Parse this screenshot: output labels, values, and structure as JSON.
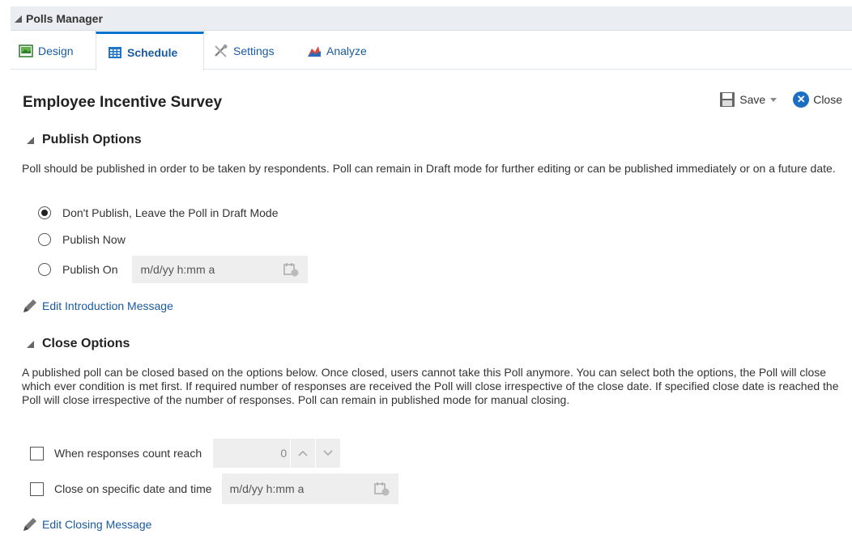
{
  "header": {
    "title": "Polls Manager"
  },
  "tabs": [
    {
      "label": "Design"
    },
    {
      "label": "Schedule"
    },
    {
      "label": "Settings"
    },
    {
      "label": "Analyze"
    }
  ],
  "page": {
    "title": "Employee Incentive Survey"
  },
  "toolbar": {
    "save_label": "Save",
    "close_label": "Close"
  },
  "publish": {
    "heading": "Publish Options",
    "description": "Poll should be published in order to be taken by respondents. Poll can remain in Draft mode for further editing or can be published immediately or on a future date.",
    "options": [
      {
        "label": "Don't Publish, Leave the Poll in Draft Mode",
        "checked": true
      },
      {
        "label": "Publish Now",
        "checked": false
      },
      {
        "label": "Publish On",
        "checked": false
      }
    ],
    "date_placeholder": "m/d/yy h:mm a",
    "edit_link": "Edit Introduction Message"
  },
  "close": {
    "heading": "Close Options",
    "description": "A published poll can be closed based on the options below. Once closed, users cannot take this Poll anymore. You can select both the options, the Poll will close which ever condition is met first. If required number of responses are received the Poll will close irrespective of the close date. If specified close date is reached the Poll will close irrespective of the number of responses. Poll can remain in published mode for manual closing.",
    "count_label": "When responses count reach",
    "count_value": "0",
    "date_label": "Close on specific date and time",
    "date_placeholder": "m/d/yy h:mm a",
    "edit_link": "Edit Closing Message"
  },
  "colors": {
    "link": "#1a5aa0",
    "accent": "#0572ce",
    "header_bg": "#eaeef2"
  }
}
